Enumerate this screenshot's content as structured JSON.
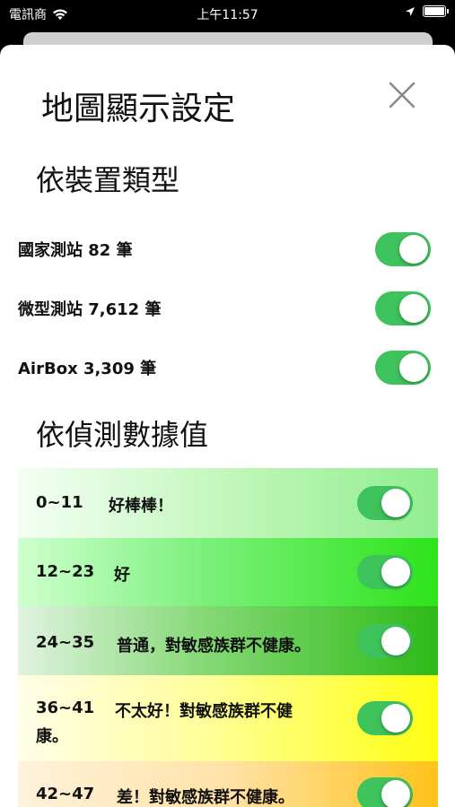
{
  "status_bar": {
    "carrier": "電訊商",
    "time": "上午11:57"
  },
  "sheet": {
    "title": "地圖顯示設定",
    "device_section": {
      "title": "依裝置類型",
      "items": [
        {
          "label": "國家測站 82 筆",
          "on": true
        },
        {
          "label": "微型測站 7,612 筆",
          "on": true
        },
        {
          "label": "AirBox 3,309 筆",
          "on": true
        }
      ]
    },
    "value_section": {
      "title": "依偵測數據值",
      "levels": [
        {
          "range": "0~11",
          "desc": "好棒棒！",
          "on": true
        },
        {
          "range": "12~23",
          "desc": "好",
          "on": true
        },
        {
          "range": "24~35",
          "desc": "普通，對敏感族群不健康。",
          "on": true
        },
        {
          "range": "36~41",
          "desc": "不太好！對敏感族群不健",
          "desc_cont": "康。",
          "on": true
        },
        {
          "range": "42~47",
          "desc": "差！對敏感族群不健康。",
          "on": true
        }
      ]
    }
  },
  "colors": {
    "toggle_on": "#3ec25b",
    "level_1": "#90ee90",
    "level_2": "#2ee31a",
    "level_3": "#2dbb17",
    "level_4": "#ffff12",
    "level_5": "#ffc21a"
  }
}
